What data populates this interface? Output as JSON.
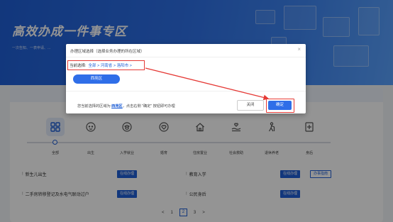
{
  "banner": {
    "title": "高效办成一件事专区",
    "subtitle": "一次告知、一表申请、..."
  },
  "categories": [
    {
      "label": "全部",
      "icon": "grid-icon",
      "active": true
    },
    {
      "label": "出生",
      "icon": "baby-icon"
    },
    {
      "label": "入学就业",
      "icon": "graduation-icon"
    },
    {
      "label": "婚育",
      "icon": "heart-icon"
    },
    {
      "label": "住房置业",
      "icon": "house-icon"
    },
    {
      "label": "社会救助",
      "icon": "hand-heart-icon"
    },
    {
      "label": "退休养老",
      "icon": "elder-icon"
    },
    {
      "label": "身后",
      "icon": "plus-box-icon"
    }
  ],
  "services": [
    {
      "name": "新生儿出生",
      "online": "在线办理"
    },
    {
      "name": "教育入学",
      "online": "在线办理",
      "guide": "办事指南"
    },
    {
      "name": "二手房转移登记及水电气联动过户",
      "online": "在线办理"
    },
    {
      "name": "公民身后",
      "online": "在线办理"
    }
  ],
  "pager": {
    "prev": "<",
    "page1": "1",
    "page2": "2",
    "page3": "3",
    "next": ">"
  },
  "dialog": {
    "title": "办理区域选择（选择业务办理的所在区域）",
    "close": "×",
    "current_label": "当前选择:",
    "current_path": "全部 > 河南省 > 洛阳市 >",
    "region_button": "西苑区",
    "note_prefix": "您当前选择的区域为:",
    "note_region": "西苑区",
    "note_suffix": "，点击右侧 \"确定\" 按钮即可办理",
    "cancel": "关闭",
    "confirm": "确定"
  },
  "colors": {
    "primary": "#1f5fd6",
    "highlight": "#e53935"
  }
}
